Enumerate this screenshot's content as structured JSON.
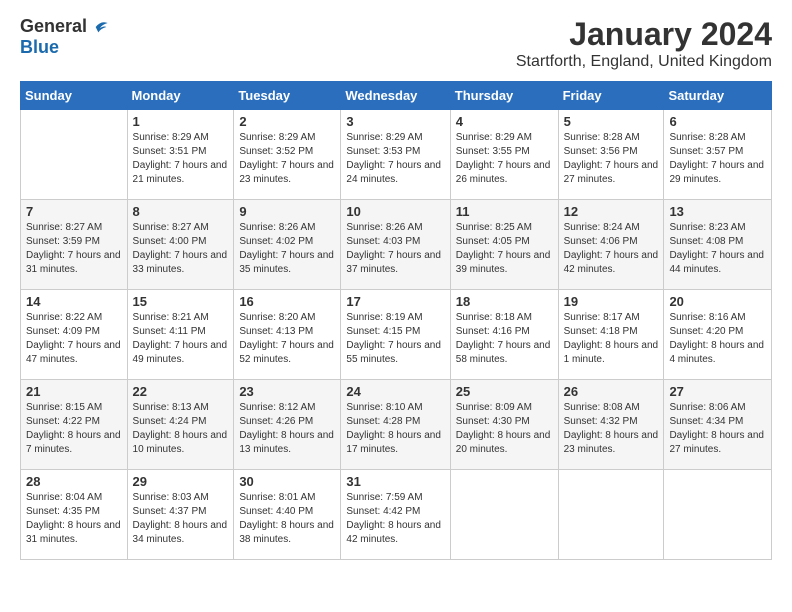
{
  "logo": {
    "general": "General",
    "blue": "Blue"
  },
  "title": "January 2024",
  "location": "Startforth, England, United Kingdom",
  "days_of_week": [
    "Sunday",
    "Monday",
    "Tuesday",
    "Wednesday",
    "Thursday",
    "Friday",
    "Saturday"
  ],
  "weeks": [
    [
      {
        "day": "",
        "sunrise": "",
        "sunset": "",
        "daylight": ""
      },
      {
        "day": "1",
        "sunrise": "Sunrise: 8:29 AM",
        "sunset": "Sunset: 3:51 PM",
        "daylight": "Daylight: 7 hours and 21 minutes."
      },
      {
        "day": "2",
        "sunrise": "Sunrise: 8:29 AM",
        "sunset": "Sunset: 3:52 PM",
        "daylight": "Daylight: 7 hours and 23 minutes."
      },
      {
        "day": "3",
        "sunrise": "Sunrise: 8:29 AM",
        "sunset": "Sunset: 3:53 PM",
        "daylight": "Daylight: 7 hours and 24 minutes."
      },
      {
        "day": "4",
        "sunrise": "Sunrise: 8:29 AM",
        "sunset": "Sunset: 3:55 PM",
        "daylight": "Daylight: 7 hours and 26 minutes."
      },
      {
        "day": "5",
        "sunrise": "Sunrise: 8:28 AM",
        "sunset": "Sunset: 3:56 PM",
        "daylight": "Daylight: 7 hours and 27 minutes."
      },
      {
        "day": "6",
        "sunrise": "Sunrise: 8:28 AM",
        "sunset": "Sunset: 3:57 PM",
        "daylight": "Daylight: 7 hours and 29 minutes."
      }
    ],
    [
      {
        "day": "7",
        "sunrise": "Sunrise: 8:27 AM",
        "sunset": "Sunset: 3:59 PM",
        "daylight": "Daylight: 7 hours and 31 minutes."
      },
      {
        "day": "8",
        "sunrise": "Sunrise: 8:27 AM",
        "sunset": "Sunset: 4:00 PM",
        "daylight": "Daylight: 7 hours and 33 minutes."
      },
      {
        "day": "9",
        "sunrise": "Sunrise: 8:26 AM",
        "sunset": "Sunset: 4:02 PM",
        "daylight": "Daylight: 7 hours and 35 minutes."
      },
      {
        "day": "10",
        "sunrise": "Sunrise: 8:26 AM",
        "sunset": "Sunset: 4:03 PM",
        "daylight": "Daylight: 7 hours and 37 minutes."
      },
      {
        "day": "11",
        "sunrise": "Sunrise: 8:25 AM",
        "sunset": "Sunset: 4:05 PM",
        "daylight": "Daylight: 7 hours and 39 minutes."
      },
      {
        "day": "12",
        "sunrise": "Sunrise: 8:24 AM",
        "sunset": "Sunset: 4:06 PM",
        "daylight": "Daylight: 7 hours and 42 minutes."
      },
      {
        "day": "13",
        "sunrise": "Sunrise: 8:23 AM",
        "sunset": "Sunset: 4:08 PM",
        "daylight": "Daylight: 7 hours and 44 minutes."
      }
    ],
    [
      {
        "day": "14",
        "sunrise": "Sunrise: 8:22 AM",
        "sunset": "Sunset: 4:09 PM",
        "daylight": "Daylight: 7 hours and 47 minutes."
      },
      {
        "day": "15",
        "sunrise": "Sunrise: 8:21 AM",
        "sunset": "Sunset: 4:11 PM",
        "daylight": "Daylight: 7 hours and 49 minutes."
      },
      {
        "day": "16",
        "sunrise": "Sunrise: 8:20 AM",
        "sunset": "Sunset: 4:13 PM",
        "daylight": "Daylight: 7 hours and 52 minutes."
      },
      {
        "day": "17",
        "sunrise": "Sunrise: 8:19 AM",
        "sunset": "Sunset: 4:15 PM",
        "daylight": "Daylight: 7 hours and 55 minutes."
      },
      {
        "day": "18",
        "sunrise": "Sunrise: 8:18 AM",
        "sunset": "Sunset: 4:16 PM",
        "daylight": "Daylight: 7 hours and 58 minutes."
      },
      {
        "day": "19",
        "sunrise": "Sunrise: 8:17 AM",
        "sunset": "Sunset: 4:18 PM",
        "daylight": "Daylight: 8 hours and 1 minute."
      },
      {
        "day": "20",
        "sunrise": "Sunrise: 8:16 AM",
        "sunset": "Sunset: 4:20 PM",
        "daylight": "Daylight: 8 hours and 4 minutes."
      }
    ],
    [
      {
        "day": "21",
        "sunrise": "Sunrise: 8:15 AM",
        "sunset": "Sunset: 4:22 PM",
        "daylight": "Daylight: 8 hours and 7 minutes."
      },
      {
        "day": "22",
        "sunrise": "Sunrise: 8:13 AM",
        "sunset": "Sunset: 4:24 PM",
        "daylight": "Daylight: 8 hours and 10 minutes."
      },
      {
        "day": "23",
        "sunrise": "Sunrise: 8:12 AM",
        "sunset": "Sunset: 4:26 PM",
        "daylight": "Daylight: 8 hours and 13 minutes."
      },
      {
        "day": "24",
        "sunrise": "Sunrise: 8:10 AM",
        "sunset": "Sunset: 4:28 PM",
        "daylight": "Daylight: 8 hours and 17 minutes."
      },
      {
        "day": "25",
        "sunrise": "Sunrise: 8:09 AM",
        "sunset": "Sunset: 4:30 PM",
        "daylight": "Daylight: 8 hours and 20 minutes."
      },
      {
        "day": "26",
        "sunrise": "Sunrise: 8:08 AM",
        "sunset": "Sunset: 4:32 PM",
        "daylight": "Daylight: 8 hours and 23 minutes."
      },
      {
        "day": "27",
        "sunrise": "Sunrise: 8:06 AM",
        "sunset": "Sunset: 4:34 PM",
        "daylight": "Daylight: 8 hours and 27 minutes."
      }
    ],
    [
      {
        "day": "28",
        "sunrise": "Sunrise: 8:04 AM",
        "sunset": "Sunset: 4:35 PM",
        "daylight": "Daylight: 8 hours and 31 minutes."
      },
      {
        "day": "29",
        "sunrise": "Sunrise: 8:03 AM",
        "sunset": "Sunset: 4:37 PM",
        "daylight": "Daylight: 8 hours and 34 minutes."
      },
      {
        "day": "30",
        "sunrise": "Sunrise: 8:01 AM",
        "sunset": "Sunset: 4:40 PM",
        "daylight": "Daylight: 8 hours and 38 minutes."
      },
      {
        "day": "31",
        "sunrise": "Sunrise: 7:59 AM",
        "sunset": "Sunset: 4:42 PM",
        "daylight": "Daylight: 8 hours and 42 minutes."
      },
      {
        "day": "",
        "sunrise": "",
        "sunset": "",
        "daylight": ""
      },
      {
        "day": "",
        "sunrise": "",
        "sunset": "",
        "daylight": ""
      },
      {
        "day": "",
        "sunrise": "",
        "sunset": "",
        "daylight": ""
      }
    ]
  ]
}
